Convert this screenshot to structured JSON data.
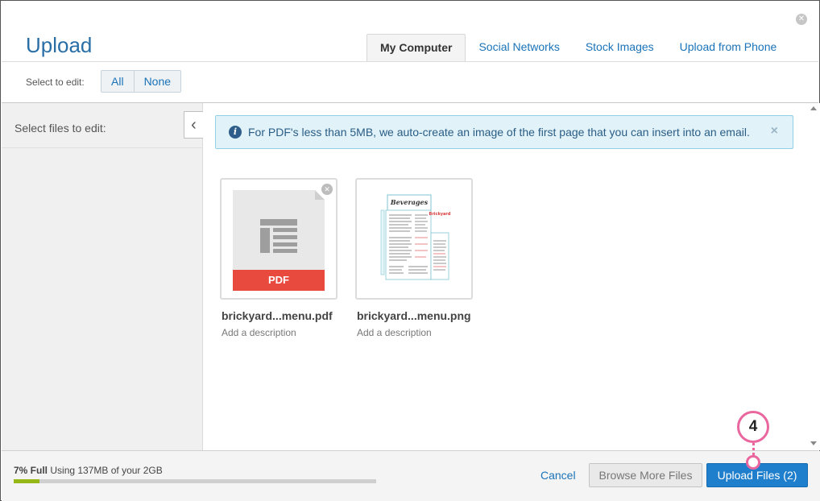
{
  "window": {
    "title": "Upload"
  },
  "tabs": [
    {
      "label": "My Computer",
      "active": true
    },
    {
      "label": "Social Networks",
      "active": false
    },
    {
      "label": "Stock Images",
      "active": false
    },
    {
      "label": "Upload from Phone",
      "active": false
    }
  ],
  "selection": {
    "label": "Select to edit:",
    "all": "All",
    "none": "None"
  },
  "sidebar": {
    "title": "Select files to edit:"
  },
  "info": {
    "text": "For PDF's less than 5MB, we auto-create an image of the first page that you can insert into an email.",
    "close": "×"
  },
  "files": [
    {
      "name": "brickyard...menu.pdf",
      "description": "Add a description",
      "badge": "PDF",
      "type": "pdf"
    },
    {
      "name": "brickyard...menu.png",
      "description": "Add a description",
      "type": "png"
    }
  ],
  "footer": {
    "usage_percent": "7% Full",
    "usage_text": "Using 137MB of your 2GB",
    "usage_fraction": 0.07,
    "cancel": "Cancel",
    "browse": "Browse More Files",
    "upload": "Upload Files (2)"
  },
  "callout": {
    "number": "4"
  },
  "colors": {
    "accent": "#1f7fcc",
    "title": "#2a6ea6",
    "pdf_banner": "#e84a3e",
    "usage_fill": "#95b816",
    "callout": "#e9669e"
  }
}
